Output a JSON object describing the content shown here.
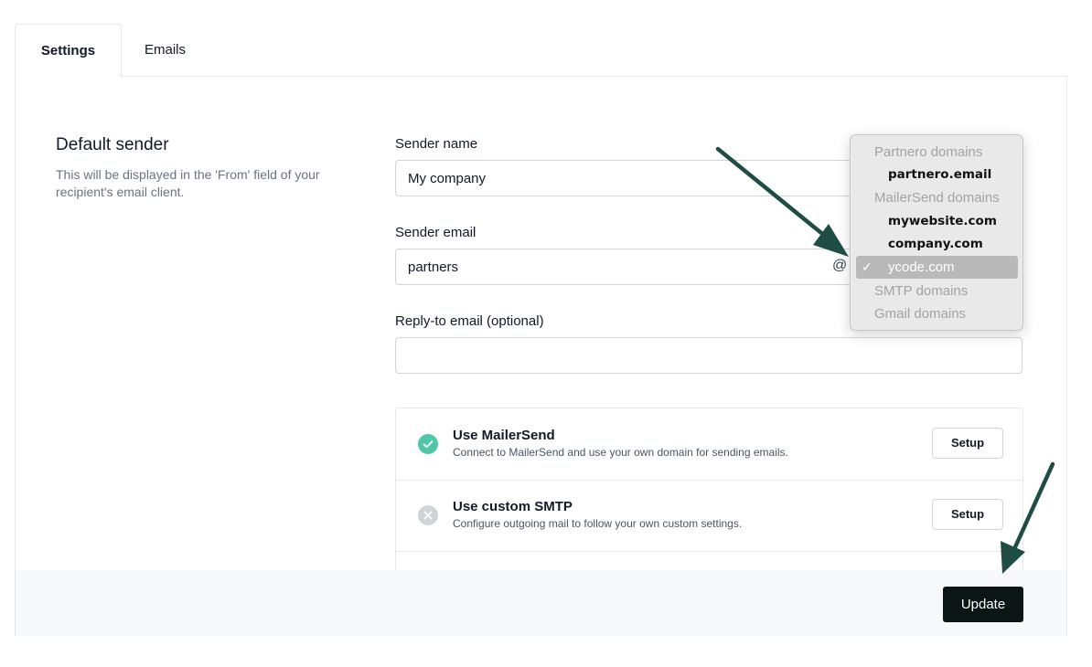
{
  "tabs": [
    {
      "label": "Settings",
      "active": true
    },
    {
      "label": "Emails",
      "active": false
    }
  ],
  "section": {
    "title": "Default sender",
    "description": "This will be displayed in the 'From' field of your recipient's email client."
  },
  "form": {
    "sender_name": {
      "label": "Sender name",
      "value": "My company"
    },
    "sender_email": {
      "label": "Sender email",
      "value": "partners",
      "at": "@"
    },
    "reply_to": {
      "label": "Reply-to email (optional)",
      "value": ""
    }
  },
  "domain_dropdown": {
    "items": [
      {
        "type": "group",
        "label": "Partnero domains"
      },
      {
        "type": "option",
        "label": "partnero.email"
      },
      {
        "type": "group",
        "label": "MailerSend domains"
      },
      {
        "type": "option",
        "label": "mywebsite.com"
      },
      {
        "type": "option",
        "label": "company.com"
      },
      {
        "type": "option",
        "label": "ycode.com",
        "selected": true,
        "check": "✓"
      },
      {
        "type": "group",
        "label": "SMTP domains"
      },
      {
        "type": "group",
        "label": "Gmail domains"
      }
    ]
  },
  "services": [
    {
      "title": "Use MailerSend",
      "description": "Connect to MailerSend and use your own domain for sending emails.",
      "status": "enabled",
      "button": "Setup"
    },
    {
      "title": "Use custom SMTP",
      "description": "Configure outgoing mail to follow your own custom settings.",
      "status": "disabled",
      "button": "Setup"
    }
  ],
  "footer": {
    "update_label": "Update"
  },
  "colors": {
    "success": "#4fc7a8",
    "disabled": "#d1d5db",
    "arrow": "#1f4d45",
    "primary_button": "#0c1715"
  }
}
